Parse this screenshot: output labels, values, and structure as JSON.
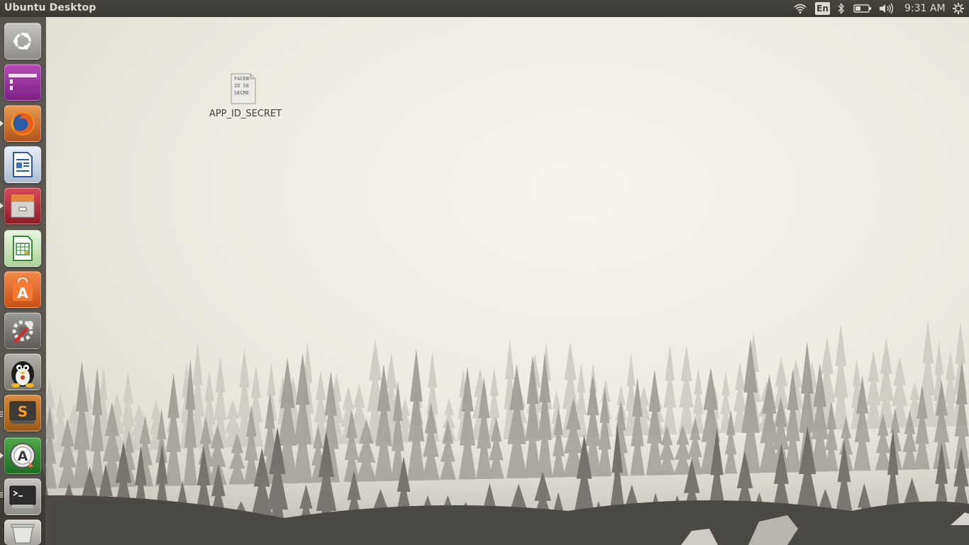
{
  "top_panel": {
    "title": "Ubuntu Desktop",
    "keyboard_layout": "En",
    "clock": "9:31 AM",
    "indicators": [
      "wifi-icon",
      "keyboard-layout",
      "bluetooth-icon",
      "battery-icon",
      "volume-icon",
      "clock",
      "system-gear-icon"
    ]
  },
  "launcher": {
    "items": [
      {
        "name": "dash-home",
        "icon": "ubuntu-logo-icon",
        "running": false
      },
      {
        "name": "workspace-switcher",
        "icon": "workspace-icon",
        "running": false
      },
      {
        "name": "firefox",
        "icon": "firefox-icon",
        "running": true
      },
      {
        "name": "libreoffice-writer",
        "icon": "writer-icon",
        "running": false
      },
      {
        "name": "files",
        "icon": "file-cabinet-icon",
        "running": true
      },
      {
        "name": "libreoffice-calc",
        "icon": "calc-icon",
        "running": false
      },
      {
        "name": "ubuntu-software",
        "icon": "software-bag-icon",
        "running": false
      },
      {
        "name": "system-settings",
        "icon": "settings-wrench-icon",
        "running": false
      },
      {
        "name": "penguin-app",
        "icon": "penguin-icon",
        "running": false
      },
      {
        "name": "sublime-text",
        "icon": "sublime-icon",
        "running": true
      },
      {
        "name": "software-updater",
        "icon": "updater-icon",
        "running": true
      },
      {
        "name": "terminal",
        "icon": "terminal-icon",
        "running": true
      },
      {
        "name": "trash",
        "icon": "trash-icon",
        "running": false
      }
    ]
  },
  "desktop": {
    "files": [
      {
        "label": "APP_ID_SECRET",
        "preview_lines": [
          "FACEB",
          "ID SE",
          "SECRE"
        ],
        "icon": "text-file-icon"
      }
    ]
  },
  "colors": {
    "panel": "#3c3b37",
    "launcher": "#3c3832",
    "wallpaper": "#efebe2"
  }
}
